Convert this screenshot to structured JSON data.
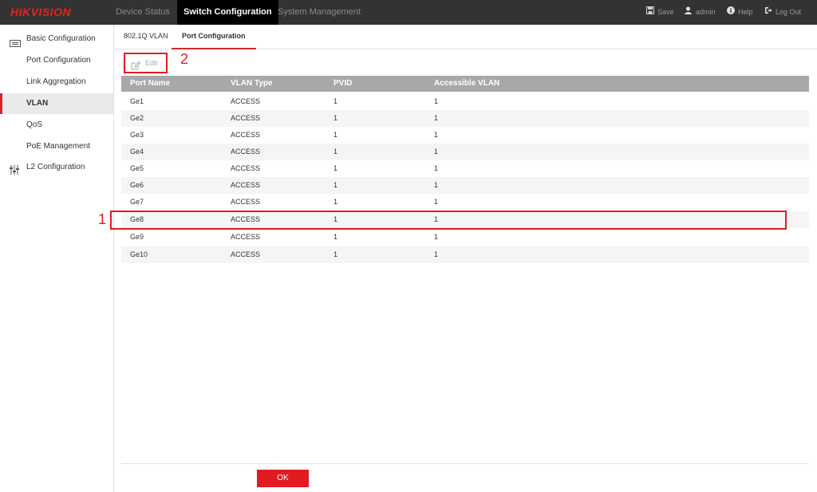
{
  "header": {
    "logo": "HIKVISION",
    "nav": [
      {
        "label": "Device Status"
      },
      {
        "label": "Switch Configuration"
      },
      {
        "label": "System Management"
      }
    ],
    "actions": {
      "save": "Save",
      "user": "admin",
      "help": "Help",
      "logout": "Log Out"
    }
  },
  "sidebar": {
    "groups": [
      {
        "label": "Basic Configuration",
        "icon": "basic-config-icon"
      },
      {
        "label": "L2 Configuration",
        "icon": "sliders-icon"
      }
    ],
    "items": [
      {
        "label": "Port Configuration"
      },
      {
        "label": "Link Aggregation"
      },
      {
        "label": "VLAN"
      },
      {
        "label": "QoS"
      },
      {
        "label": "PoE Management"
      }
    ]
  },
  "tabs": [
    {
      "label": "802.1Q VLAN"
    },
    {
      "label": "Port Configuration"
    }
  ],
  "toolbar": {
    "edit_label": "Edit"
  },
  "annotations": {
    "one": "1",
    "two": "2"
  },
  "table": {
    "headers": [
      "Port Name",
      "VLAN Type",
      "PVID",
      "Accessible VLAN"
    ],
    "rows": [
      [
        "Ge1",
        "ACCESS",
        "1",
        "1"
      ],
      [
        "Ge2",
        "ACCESS",
        "1",
        "1"
      ],
      [
        "Ge3",
        "ACCESS",
        "1",
        "1"
      ],
      [
        "Ge4",
        "ACCESS",
        "1",
        "1"
      ],
      [
        "Ge5",
        "ACCESS",
        "1",
        "1"
      ],
      [
        "Ge6",
        "ACCESS",
        "1",
        "1"
      ],
      [
        "Ge7",
        "ACCESS",
        "1",
        "1"
      ],
      [
        "Ge8",
        "ACCESS",
        "1",
        "1"
      ],
      [
        "Ge9",
        "ACCESS",
        "1",
        "1"
      ],
      [
        "Ge10",
        "ACCESS",
        "1",
        "1"
      ]
    ]
  },
  "footer": {
    "ok_label": "OK"
  },
  "colors": {
    "accent": "#e21b23",
    "topbar": "#333333",
    "header_row": "#a8a8a8"
  }
}
